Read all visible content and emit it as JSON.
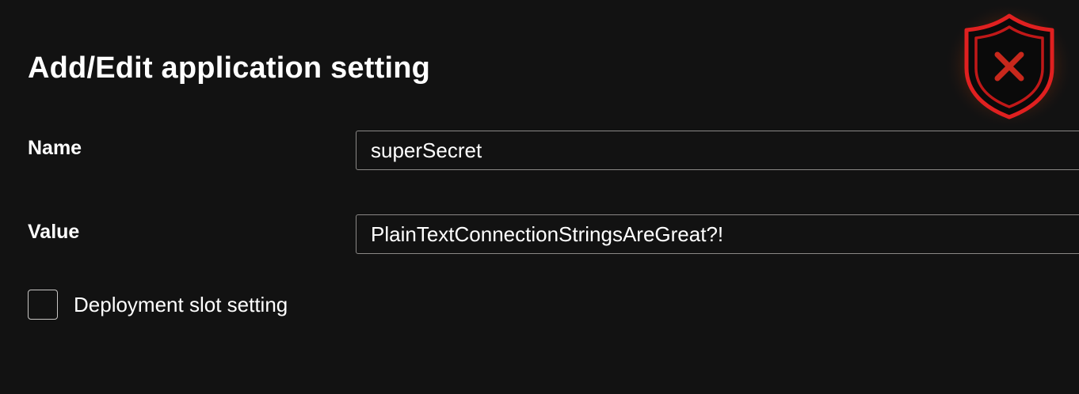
{
  "dialog": {
    "title": "Add/Edit application setting"
  },
  "fields": {
    "name": {
      "label": "Name",
      "value": "superSecret"
    },
    "value": {
      "label": "Value",
      "value": "PlainTextConnectionStringsAreGreat?!"
    }
  },
  "deployment_slot": {
    "label": "Deployment slot setting",
    "checked": false
  },
  "badge": {
    "icon": "shield-x-icon",
    "color": "#d42020",
    "glow_color": "#e85a10"
  }
}
